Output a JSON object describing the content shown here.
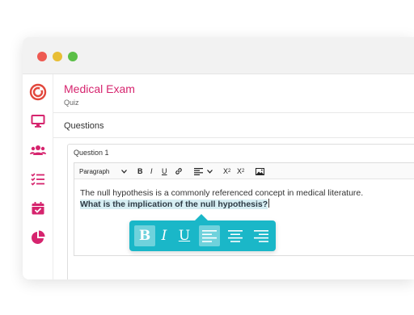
{
  "window": {
    "controls": [
      "close",
      "minimize",
      "maximize"
    ]
  },
  "sidebar": {
    "icons": [
      "logo-icon",
      "monitor-icon",
      "users-icon",
      "checklist-icon",
      "calendar-check-icon",
      "pie-chart-icon"
    ],
    "accent": "#d6246e"
  },
  "header": {
    "title": "Medical Exam",
    "subtitle": "Quiz"
  },
  "section": {
    "title": "Questions"
  },
  "question": {
    "label": "Question 1",
    "toolbar": {
      "format": "Paragraph",
      "bold": "B",
      "italic": "I",
      "underline": "U",
      "subscript": "X",
      "subscript_mark": "2",
      "superscript": "X",
      "superscript_mark": "2"
    },
    "body_text": "The null hypothesis is a commonly referenced concept in medical literature.",
    "highlighted_text": "What is the implication of the null hypothesis?"
  },
  "floating_toolbar": {
    "bold": "B",
    "italic": "I",
    "underline": "U",
    "active": [
      "bold",
      "align-left"
    ],
    "color": "#1ab7c8"
  }
}
